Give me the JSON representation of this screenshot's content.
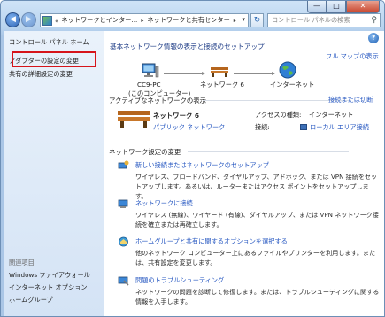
{
  "window": {
    "minimize_glyph": "—",
    "maximize_glyph": "□",
    "close_glyph": "✕"
  },
  "nav": {
    "back_glyph": "◀",
    "forward_glyph": "▶",
    "address_prefix": "«",
    "breadcrumb_1": "ネットワークとインター...",
    "breadcrumb_2": "ネットワークと共有センター",
    "separator": "▸",
    "dropdown_glyph": "▾",
    "refresh_glyph": "↻",
    "search_placeholder": "コントロール パネルの検索",
    "search_glyph": "⚲"
  },
  "sidebar": {
    "home": "コントロール パネル ホーム",
    "adapter_settings": "アダプターの設定の変更",
    "sharing_settings": "共有の詳細設定の変更",
    "see_also": "関連項目",
    "firewall": "Windows ファイアウォール",
    "internet_options": "インターネット オプション",
    "homegroup": "ホームグループ"
  },
  "main": {
    "help_glyph": "?",
    "heading": "基本ネットワーク情報の表示と接続のセットアップ",
    "full_map": "フル マップの表示",
    "map": {
      "computer_name": "CC9-PC",
      "computer_sub": "(このコンピューター)",
      "network": "ネットワーク 6",
      "internet": "インターネット"
    },
    "active_networks_label": "アクティブなネットワークの表示",
    "connect_disconnect": "接続または切断",
    "active_network": {
      "name": "ネットワーク 6",
      "type": "パブリック ネットワーク",
      "access_type_label": "アクセスの種類:",
      "access_type_value": "インターネット",
      "connections_label": "接続:",
      "connections_value": "ローカル エリア接続"
    },
    "change_settings_label": "ネットワーク設定の変更",
    "tasks": [
      {
        "title": "新しい接続またはネットワークのセットアップ",
        "desc": "ワイヤレス、ブロードバンド、ダイヤルアップ、アドホック、または VPN 接続をセットアップします。あるいは、ルーターまたはアクセス ポイントをセットアップします。"
      },
      {
        "title": "ネットワークに接続",
        "desc": "ワイヤレス (無線)、ワイヤード (有線)、ダイヤルアップ、または VPN ネットワーク接続を確立または再確立します。"
      },
      {
        "title": "ホームグループと共有に関するオプションを選択する",
        "desc": "他のネットワーク コンピューター上にあるファイルやプリンターを利用します。または、共有設定を変更します。"
      },
      {
        "title": "問題のトラブルシューティング",
        "desc": "ネットワークの問題を診断して修復します。または、トラブルシューティングに関する情報を入手します。"
      }
    ]
  },
  "colors": {
    "link": "#2657c1",
    "heading": "#1e3c86",
    "highlight_box": "#d6141a"
  }
}
